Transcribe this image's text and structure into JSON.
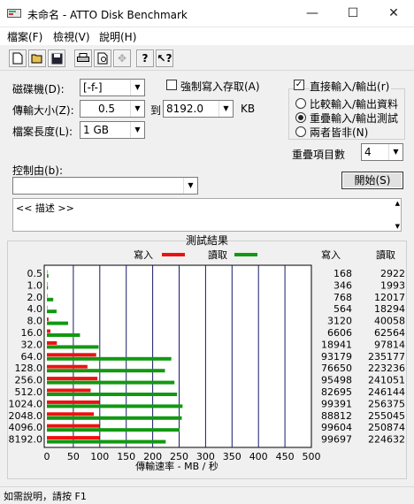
{
  "window": {
    "title": "未命名 - ATTO Disk Benchmark",
    "minimize_icon": "minimize-icon",
    "maximize_icon": "maximize-icon",
    "close_icon": "close-icon"
  },
  "menu": [
    "檔案(F)",
    "檢視(V)",
    "說明(H)"
  ],
  "toolbar": [
    "new-file-icon",
    "open-folder-icon",
    "save-icon",
    "print-icon",
    "print-preview-icon",
    "move-icon",
    "help-icon",
    "context-help-icon"
  ],
  "form": {
    "drive_label": "磁碟機(D):",
    "drive_value": "[-f-]",
    "force_write_label": "強制寫入存取(A)",
    "transfer_size_label": "傳輸大小(Z):",
    "transfer_from": "0.5",
    "to_label": "到",
    "transfer_to": "8192.0",
    "kb_label": "KB",
    "file_length_label": "檔案長度(L):",
    "file_length_value": "1 GB",
    "controlled_by_label": "控制由(b):",
    "controlled_by_value": ""
  },
  "io_options": {
    "direct_io_label": "直接輸入/輸出(r)",
    "direct_io_checked": true,
    "radios": [
      {
        "label": "比較輸入/輸出資料",
        "selected": false
      },
      {
        "label": "重疊輸入/輸出測試",
        "selected": true
      },
      {
        "label": "兩者皆非(N)",
        "selected": false
      }
    ],
    "queue_depth_label": "重疊項目數",
    "queue_depth_value": "4"
  },
  "start_button": "開始(S)",
  "description": "<< 描述 >>",
  "results": {
    "title": "測試結果",
    "write_legend": "寫入",
    "read_legend": "讀取",
    "col_write": "寫入",
    "col_read": "讀取",
    "xlabel": "傳輸速率 - MB / 秒"
  },
  "chart_data": {
    "type": "bar",
    "title": "測試結果",
    "categories": [
      "0.5",
      "1.0",
      "2.0",
      "4.0",
      "8.0",
      "16.0",
      "32.0",
      "64.0",
      "128.0",
      "256.0",
      "512.0",
      "1024.0",
      "2048.0",
      "4096.0",
      "8192.0"
    ],
    "series": [
      {
        "name": "寫入",
        "color": "#ee1111",
        "values_mb": [
          0.2,
          0.3,
          0.8,
          0.6,
          3.1,
          6.6,
          18.9,
          93.2,
          76.7,
          95.5,
          82.7,
          99.4,
          88.8,
          99.6,
          99.7
        ],
        "table_values": [
          168,
          346,
          768,
          564,
          3120,
          6606,
          18941,
          93179,
          76650,
          95498,
          82695,
          99391,
          88812,
          99604,
          99697
        ]
      },
      {
        "name": "讀取",
        "color": "#119911",
        "values_mb": [
          2.9,
          2.0,
          12.0,
          18.3,
          40.1,
          62.6,
          97.8,
          235.2,
          223.2,
          241.1,
          246.1,
          256.4,
          255.0,
          250.9,
          224.6
        ],
        "table_values": [
          2922,
          1993,
          12017,
          18294,
          40058,
          62564,
          97814,
          235177,
          223236,
          241051,
          246144,
          256375,
          255045,
          250874,
          224632
        ]
      }
    ],
    "xlabel": "傳輸速率 - MB / 秒",
    "xlim": [
      0,
      500
    ],
    "xticks": [
      "0",
      "50",
      "100",
      "150",
      "200",
      "250",
      "300",
      "350",
      "400",
      "450",
      "500"
    ]
  },
  "status": "如需說明，請按 F1"
}
